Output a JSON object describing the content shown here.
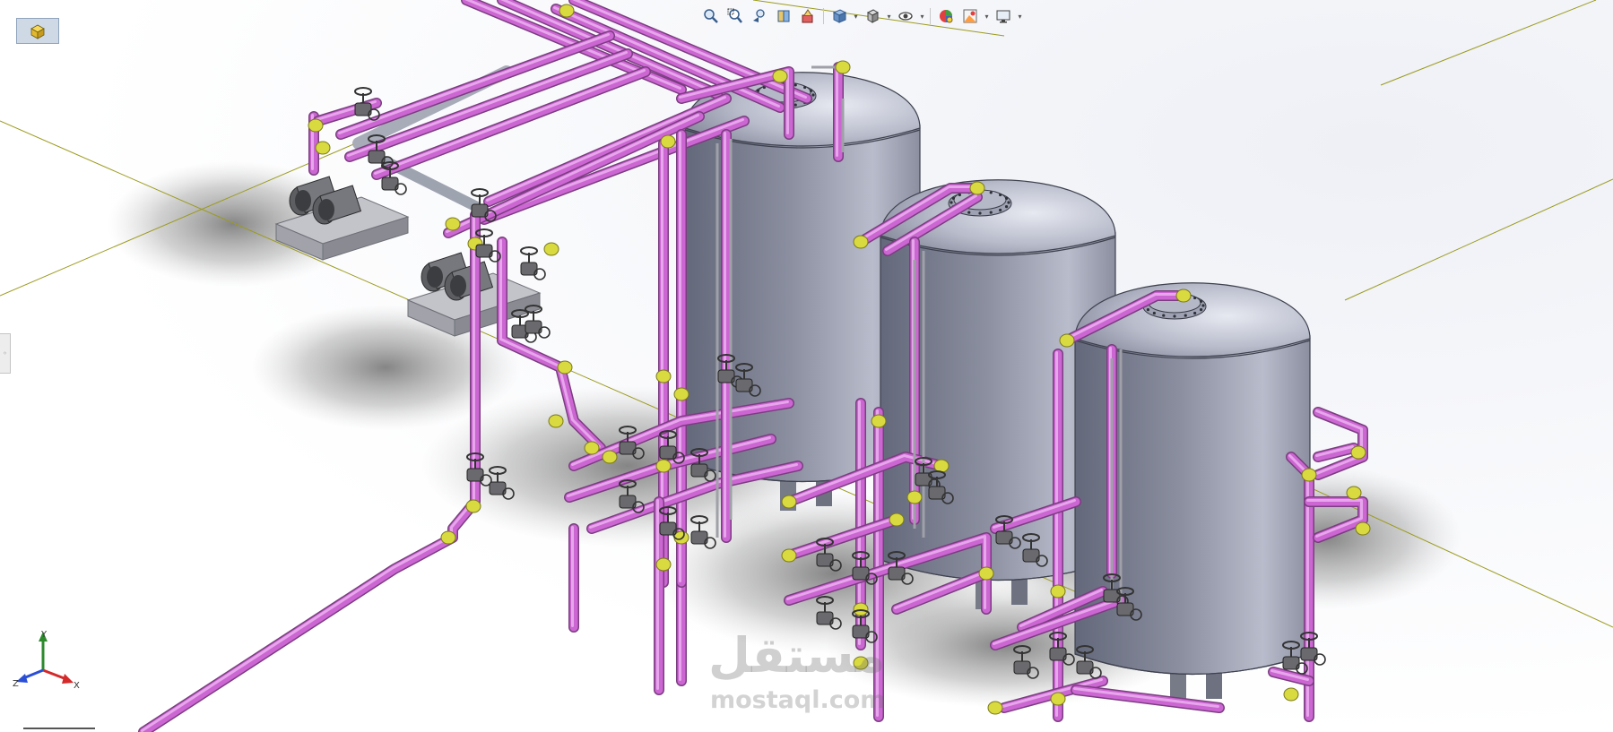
{
  "viewport": {
    "background": "#ffffff",
    "shadow": "#9a9a9a"
  },
  "colors": {
    "pipe": "#cc66d2",
    "pipe_light": "#e7a6ec",
    "fitting": "#d9d940",
    "tank_body": "#8b8fa0",
    "tank_light": "#b8bccb",
    "tank_dark": "#63687a",
    "valve": "#4f4f4f",
    "base": "#a2a3aa",
    "grid_line": "#9b9b1e",
    "axis_x": "#d42a2a",
    "axis_y": "#2c8a2c",
    "axis_z": "#2a4fd6"
  },
  "toolbar": {
    "items": [
      {
        "icon": "zoom-to-fit-icon"
      },
      {
        "icon": "zoom-to-area-icon"
      },
      {
        "icon": "previous-view-icon"
      },
      {
        "icon": "section-view-icon"
      },
      {
        "icon": "dynamic-annotation-icon"
      },
      {
        "icon": "view-orientation-icon",
        "dropdown": true
      },
      {
        "icon": "display-style-icon",
        "dropdown": true
      },
      {
        "icon": "hide-show-items-icon",
        "dropdown": true
      },
      {
        "icon": "edit-appearance-icon"
      },
      {
        "icon": "apply-scene-icon",
        "dropdown": true
      },
      {
        "icon": "view-settings-icon",
        "dropdown": true
      }
    ]
  },
  "view_button": {
    "icon": "view-cube-icon"
  },
  "triad": {
    "x": "X",
    "y": "Y",
    "z": "Z"
  },
  "watermark": {
    "arabic": "مستقل",
    "latin": "mostaql.com"
  }
}
